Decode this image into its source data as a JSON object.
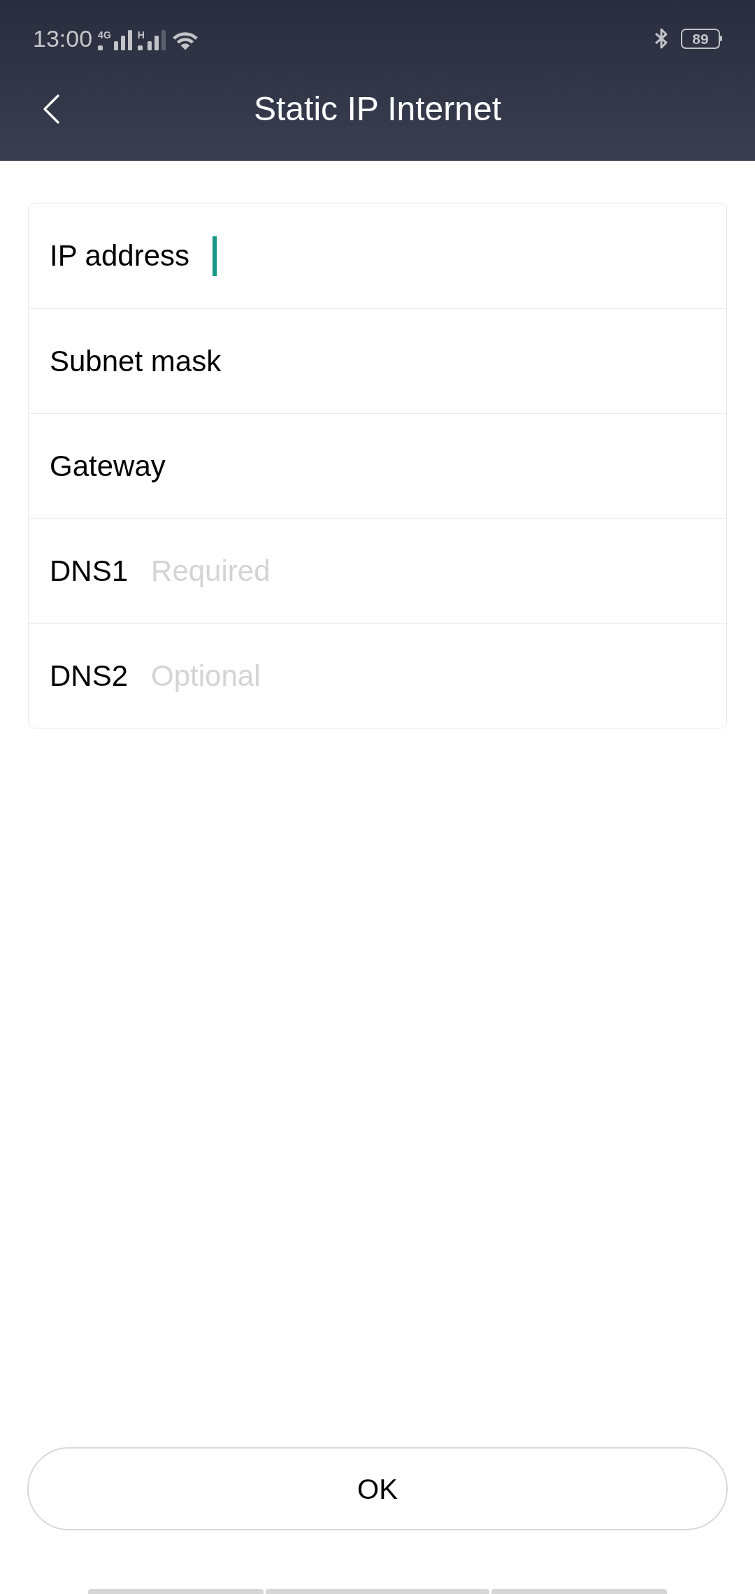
{
  "status_bar": {
    "time": "13:00",
    "signals": [
      {
        "network": "4G"
      },
      {
        "network": "H"
      }
    ],
    "battery": "89"
  },
  "header": {
    "title": "Static IP Internet"
  },
  "fields": [
    {
      "label": "IP address",
      "focused": true
    },
    {
      "label": "Subnet mask",
      "focused": false
    },
    {
      "label": "Gateway",
      "focused": false
    },
    {
      "label": "DNS1",
      "placeholder": "Required",
      "focused": false
    },
    {
      "label": "DNS2",
      "placeholder": "Optional",
      "focused": false
    }
  ],
  "button": {
    "label": "OK"
  }
}
